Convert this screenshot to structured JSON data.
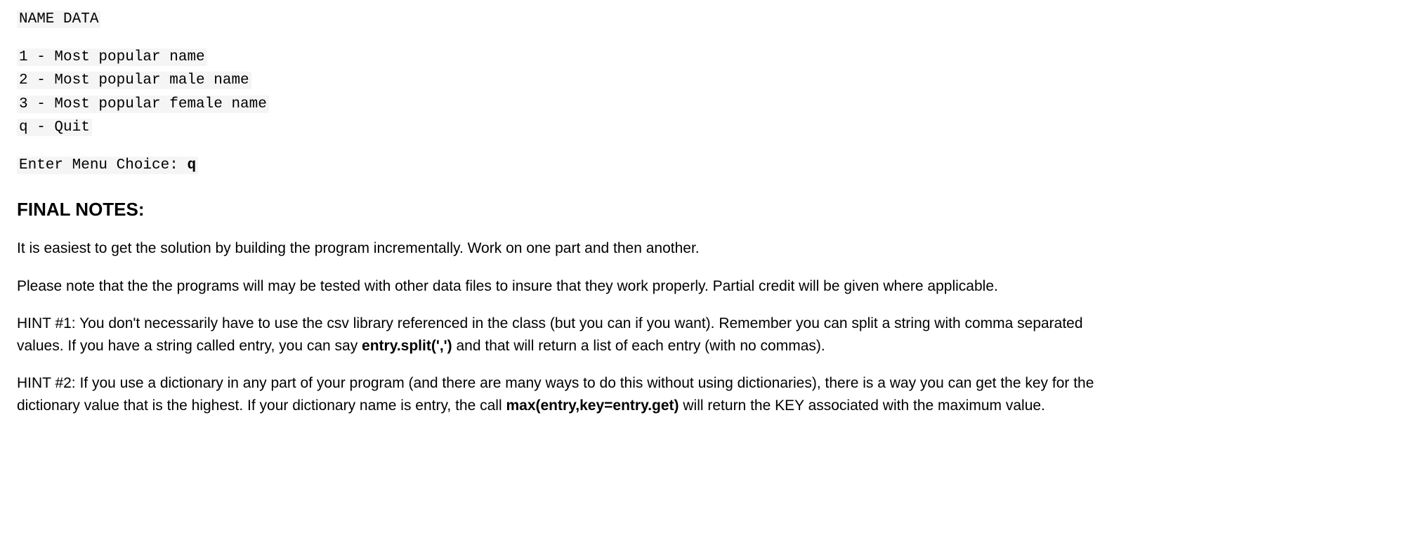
{
  "code": {
    "header": "NAME DATA",
    "opt1": "1 - Most popular name",
    "opt2": "2 - Most popular male name",
    "opt3": "3 - Most popular female name",
    "optq": "q - Quit",
    "prompt": "Enter Menu Choice: ",
    "input": "q"
  },
  "notes": {
    "heading": "FINAL NOTES:",
    "p1": "It is easiest to get the solution by building the program incrementally. Work on one part and then another.",
    "p2": "Please note that the the programs will may be tested with other data files to insure that they work properly. Partial credit will be given where applicable.",
    "hint1_a": "HINT #1: You don't necessarily have to use the csv library referenced in the class (but you can if you want). Remember you can split a string with comma separated values. If you have a string called entry, you can say ",
    "hint1_code": "entry.split(',')",
    "hint1_b": " and that will return a list of each entry (with no commas).",
    "hint2_a": "HINT #2: If you use a dictionary in any part of your program (and there are many ways to do this without using dictionaries), there is a way you can get the key for the dictionary value that is the highest. If your dictionary name is entry, the call ",
    "hint2_code": "max(entry,key=entry.get)",
    "hint2_b": " will return the KEY associated with the maximum value."
  }
}
